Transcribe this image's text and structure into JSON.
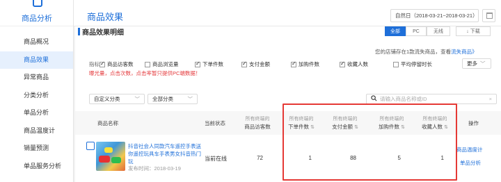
{
  "sidebar": {
    "title": "商品分析",
    "items": [
      {
        "label": "商品概况",
        "active": false
      },
      {
        "label": "商品效果",
        "active": true
      },
      {
        "label": "异常商品",
        "active": false
      },
      {
        "label": "分类分析",
        "active": false
      },
      {
        "label": "单品分析",
        "active": false
      },
      {
        "label": "商品温度计",
        "active": false
      },
      {
        "label": "销量预测",
        "active": false
      },
      {
        "label": "单品服务分析",
        "active": false
      }
    ]
  },
  "header": {
    "title": "商品效果",
    "date_range": "自然日（2018-03-21~2018-03-21）"
  },
  "section": {
    "title": "商品效果明细",
    "segments": [
      {
        "label": "全部",
        "active": true
      },
      {
        "label": "PC",
        "active": false
      },
      {
        "label": "无线",
        "active": false
      }
    ],
    "download": "下载"
  },
  "notice": {
    "text": "您的店铺存在1款流失商品，查看",
    "link": "流失商品》"
  },
  "metrics": {
    "prefix": "指标：",
    "items": [
      {
        "label": "商品访客数",
        "checked": true
      },
      {
        "label": "商品浏览量",
        "checked": false
      },
      {
        "label": "下单件数",
        "checked": true
      },
      {
        "label": "支付金额",
        "checked": true
      },
      {
        "label": "加购件数",
        "checked": true
      },
      {
        "label": "收藏人数",
        "checked": true
      },
      {
        "label": "平均停留时长",
        "checked": false
      }
    ],
    "more": "更多",
    "warning": "曝光量，点击次数，点击率暂只提供PC端数据！"
  },
  "filters": {
    "custom_category": "自定义分类",
    "all_category": "全部分类",
    "search_placeholder": "请输入商品名称或ID"
  },
  "table": {
    "headers": {
      "name": "商品名称",
      "status": "当前状态",
      "visitors_sub": "所有终端的",
      "visitors": "商品访客数",
      "orders_sub": "所有终端的",
      "orders": "下单件数",
      "pay_sub": "所有终端的",
      "pay": "支付金额",
      "cart_sub": "所有终端的",
      "cart": "加购件数",
      "fav_sub": "所有终端的",
      "fav": "收藏人数",
      "op": "操作"
    },
    "rows": [
      {
        "name": "抖音社会人同款汽车遥控手表送你遥控玩具车手表男女抖音热门玩",
        "publish": "发布时间：2018-03-19",
        "status": "当前在线",
        "visitors": "72",
        "orders": "1",
        "pay": "88",
        "cart": "5",
        "fav": "1",
        "op1": "商品温度计",
        "op2": "单品分析"
      }
    ]
  },
  "colors": {
    "accent": "#1e6fd9",
    "highlight_box": "#e53935",
    "warning": "#e4393c"
  }
}
